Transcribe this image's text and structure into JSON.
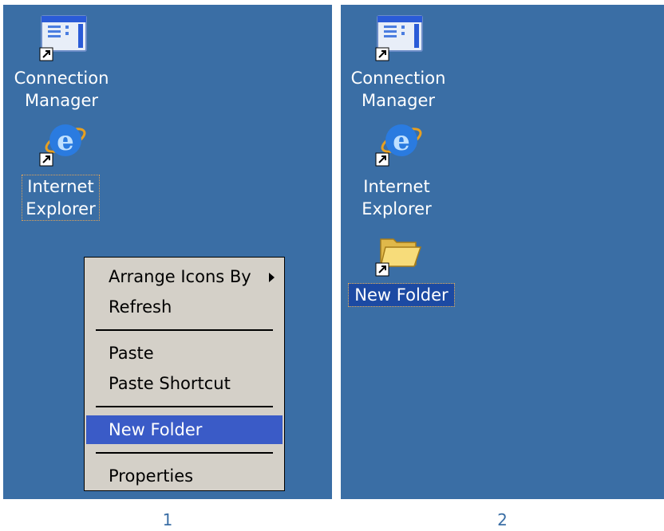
{
  "panels": [
    {
      "caption": "1",
      "icons": [
        {
          "name": "connection-manager",
          "label_line1": "Connection",
          "label_line2": "Manager"
        },
        {
          "name": "internet-explorer",
          "label_line1": "Internet",
          "label_line2": "Explorer"
        }
      ],
      "context_menu": {
        "items": [
          {
            "label": "Arrange Icons By",
            "has_submenu": true
          },
          {
            "label": "Refresh"
          },
          {
            "label": "Paste"
          },
          {
            "label": "Paste Shortcut"
          },
          {
            "label": "New Folder",
            "highlighted": true
          },
          {
            "label": "Properties"
          }
        ]
      }
    },
    {
      "caption": "2",
      "icons": [
        {
          "name": "connection-manager",
          "label_line1": "Connection",
          "label_line2": "Manager"
        },
        {
          "name": "internet-explorer",
          "label_line1": "Internet",
          "label_line2": "Explorer"
        },
        {
          "name": "new-folder",
          "label_line1": "New Folder",
          "selected": true
        }
      ]
    }
  ],
  "colors": {
    "desktop": "#3a6ea5",
    "menu_background": "#d4d0c8",
    "menu_highlight": "#3a5bc7",
    "selection": "#1c4aa3",
    "caption_text": "#3a6ea5"
  },
  "icon_names": {
    "connection-manager": "connection-manager-icon",
    "internet-explorer": "internet-explorer-icon",
    "new-folder": "folder-icon",
    "shortcut-overlay": "shortcut-arrow-icon",
    "submenu": "submenu-arrow-icon"
  }
}
